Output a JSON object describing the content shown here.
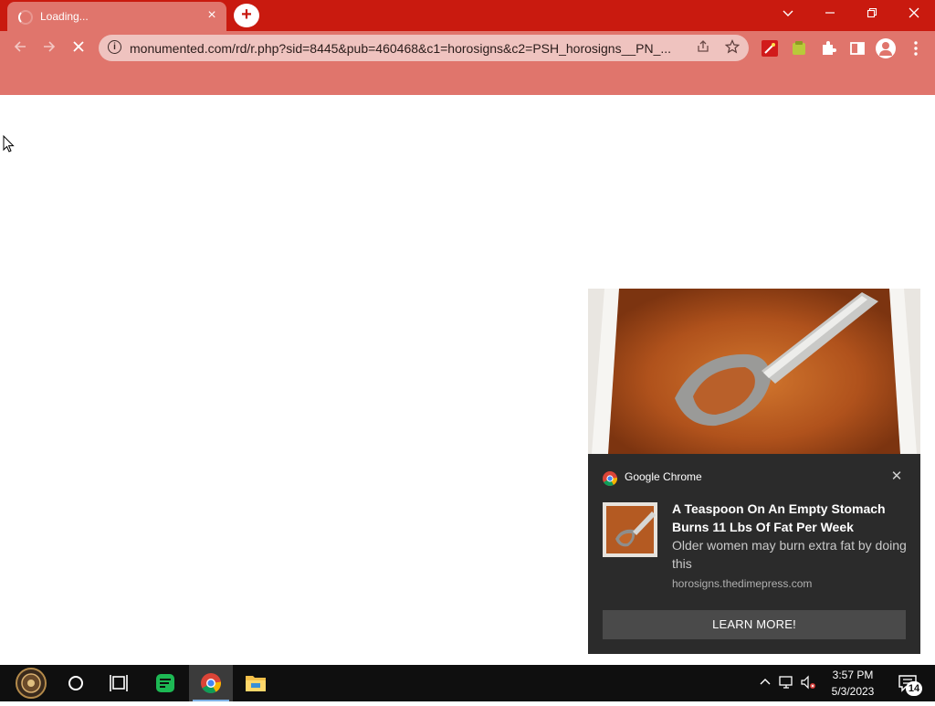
{
  "browser": {
    "tab": {
      "title": "Loading..."
    },
    "new_tab_label": "+",
    "url": "monumented.com/rd/r.php?sid=8445&pub=460468&c1=horosigns&c2=PSH_horosigns__PN_...",
    "theme_color": "#c91a0f",
    "toolbar_color": "#e0756c"
  },
  "notification": {
    "app_name": "Google Chrome",
    "title": "A Teaspoon On An Empty Stomach Burns 11 Lbs Of Fat Per Week",
    "body": "Older women may burn extra fat by doing this",
    "source": "horosigns.thedimepress.com",
    "action_label": "LEARN MORE!",
    "close_glyph": "✕"
  },
  "taskbar": {
    "clock_time": "3:57 PM",
    "clock_date": "5/3/2023",
    "notification_count": "14",
    "pinned_icons": [
      "start-icon",
      "cortana-icon",
      "task-view-icon",
      "green-app-icon",
      "chrome-icon",
      "file-explorer-icon"
    ]
  }
}
